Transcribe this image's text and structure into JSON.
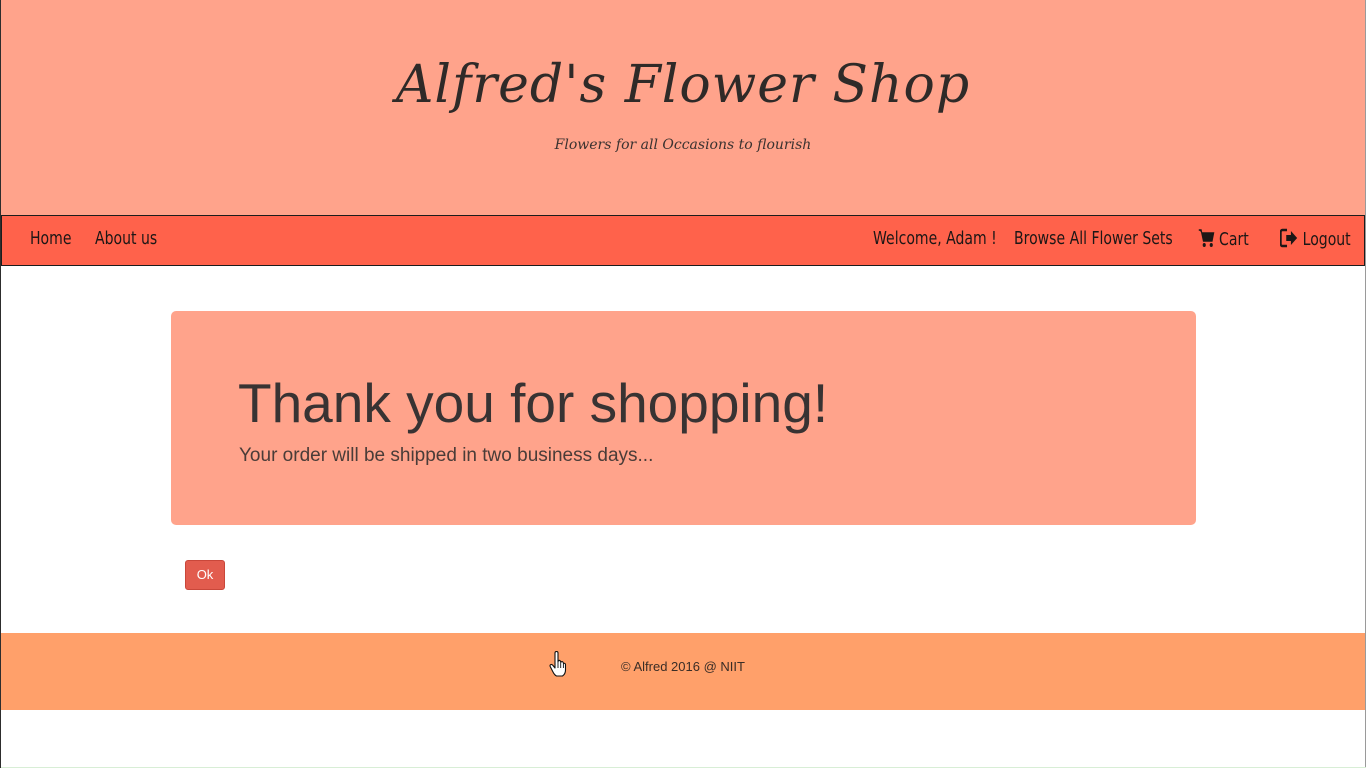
{
  "header": {
    "title": "Alfred's Flower Shop",
    "tagline": "Flowers for all Occasions to flourish"
  },
  "nav": {
    "home": "Home",
    "about": "About us",
    "welcome": "Welcome, Adam !",
    "browse": "Browse All Flower Sets",
    "cart": "Cart",
    "logout": "Logout",
    "cart_icon": "shopping-cart-icon",
    "logout_icon": "logout-icon"
  },
  "jumbotron": {
    "heading": "Thank you for shopping!",
    "message": "Your order will be shipped in two business days..."
  },
  "actions": {
    "ok_label": "Ok"
  },
  "footer": {
    "copyright": "© Alfred 2016 @ NIIT"
  },
  "colors": {
    "header_bg": "#ffa38b",
    "navbar_bg": "#ff624b",
    "jumbotron_bg": "#ffa38b",
    "button_bg": "#e25c4e",
    "footer_bg": "#ffa06a"
  }
}
